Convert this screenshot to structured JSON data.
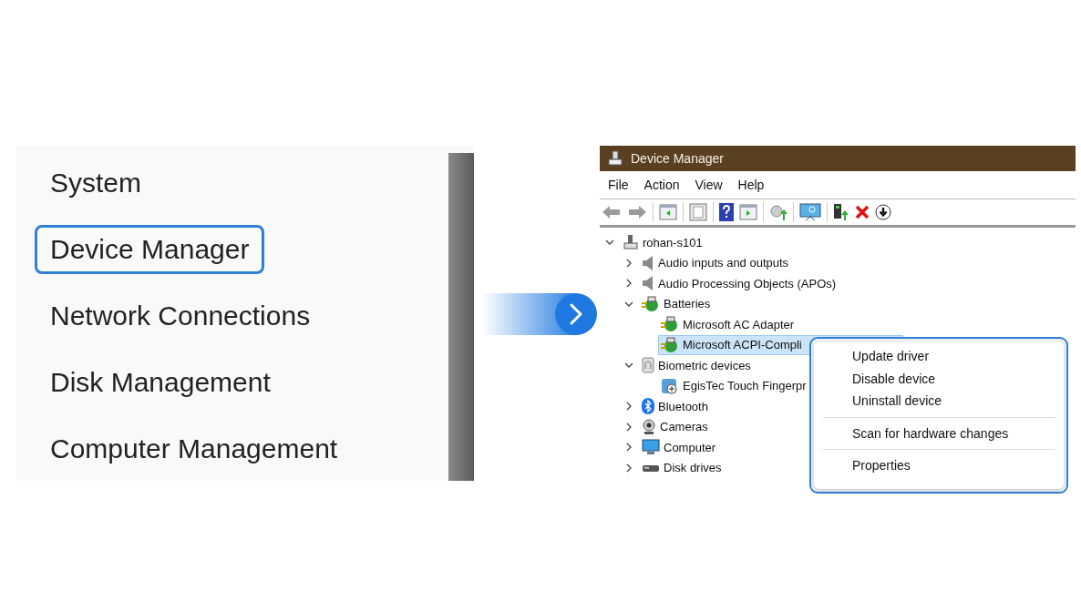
{
  "quick_menu": {
    "items": [
      {
        "label": "System",
        "selected": false
      },
      {
        "label": "Device Manager",
        "selected": true
      },
      {
        "label": "Network Connections",
        "selected": false
      },
      {
        "label": "Disk Management",
        "selected": false
      },
      {
        "label": "Computer Management",
        "selected": false
      }
    ]
  },
  "window": {
    "title": "Device Manager",
    "menu": [
      "File",
      "Action",
      "View",
      "Help"
    ]
  },
  "tree": {
    "label": "rohan-s101",
    "kind": "computer",
    "expanded": true,
    "selected": false,
    "children": [
      {
        "label": "Audio inputs and outputs",
        "kind": "speaker",
        "expanded": false,
        "selected": false
      },
      {
        "label": "Audio Processing Objects (APOs)",
        "kind": "speaker",
        "expanded": false,
        "selected": false
      },
      {
        "label": "Batteries",
        "kind": "battery",
        "expanded": true,
        "selected": false,
        "children": [
          {
            "label": "Microsoft AC Adapter",
            "kind": "battery",
            "selected": false
          },
          {
            "label": "Microsoft ACPI-Compli",
            "kind": "battery",
            "selected": true
          }
        ]
      },
      {
        "label": "Biometric devices",
        "kind": "biometric",
        "expanded": true,
        "selected": false,
        "children": [
          {
            "label": "EgisTec Touch Fingerpr",
            "kind": "fingerprint",
            "selected": false
          }
        ]
      },
      {
        "label": "Bluetooth",
        "kind": "bluetooth",
        "expanded": false,
        "selected": false
      },
      {
        "label": "Cameras",
        "kind": "camera",
        "expanded": false,
        "selected": false
      },
      {
        "label": "Computer",
        "kind": "monitor",
        "expanded": false,
        "selected": false
      },
      {
        "label": "Disk drives",
        "kind": "disk",
        "expanded": false,
        "selected": false
      }
    ]
  },
  "context_menu": {
    "groups": [
      [
        "Update driver",
        "Disable device",
        "Uninstall device"
      ],
      [
        "Scan for hardware changes"
      ],
      [
        "Properties"
      ]
    ]
  }
}
